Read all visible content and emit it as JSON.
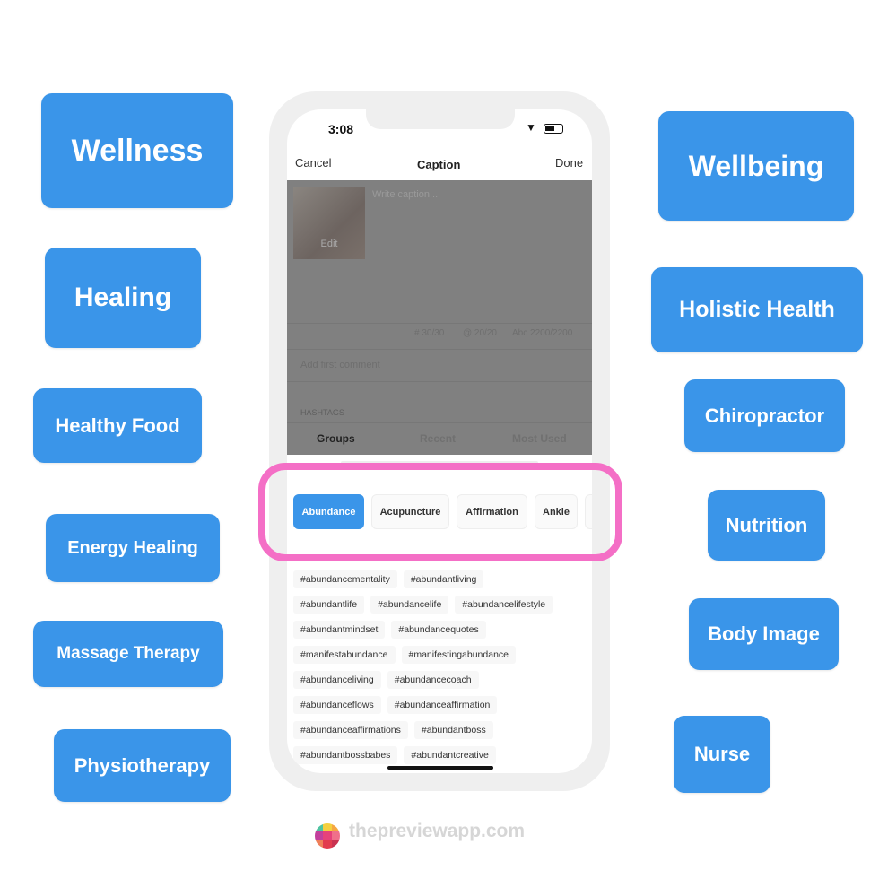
{
  "left_tags": [
    "Wellness",
    "Healing",
    "Healthy Food",
    "Energy Healing",
    "Massage Therapy",
    "Physiotherapy"
  ],
  "right_tags": [
    "Wellbeing",
    "Holistic Health",
    "Chiropractor",
    "Nutrition",
    "Body Image",
    "Nurse"
  ],
  "phone": {
    "time": "3:08",
    "nav": {
      "cancel": "Cancel",
      "title": "Caption",
      "done": "Done"
    },
    "caption_placeholder": "Write caption...",
    "thumb_edit": "Edit",
    "counters": {
      "hashtags": "# 30/30",
      "mentions": "@ 20/20",
      "chars": "Abc 2200/2200"
    },
    "comment_placeholder": "Add first comment",
    "hashtags_label": "HASHTAGS",
    "tabs": [
      "Groups",
      "Recent",
      "Most Used"
    ],
    "groups": [
      "Abundance",
      "Acupuncture",
      "Affirmation",
      "Ankle"
    ],
    "selected_group": "Abundance",
    "hashtag_rows": [
      [
        "#abundancementality",
        "#abundantliving"
      ],
      [
        "#abundantlife",
        "#abundancelife",
        "#abundancelifestyle"
      ],
      [
        "#abundantmindset",
        "#abundancequotes"
      ],
      [
        "#manifestabundance",
        "#manifestingabundance"
      ],
      [
        "#abundanceliving",
        "#abundancecoach"
      ],
      [
        "#abundanceflows",
        "#abundanceaffirmation"
      ],
      [
        "#abundanceaffirmations",
        "#abundantboss"
      ],
      [
        "#abundantbossbabes",
        "#abundantcreative"
      ]
    ]
  },
  "footer": {
    "brand": "thepreviewapp.com"
  },
  "colors": {
    "tag_blue": "#3a95e9",
    "highlight_pink": "#f46fc6"
  }
}
